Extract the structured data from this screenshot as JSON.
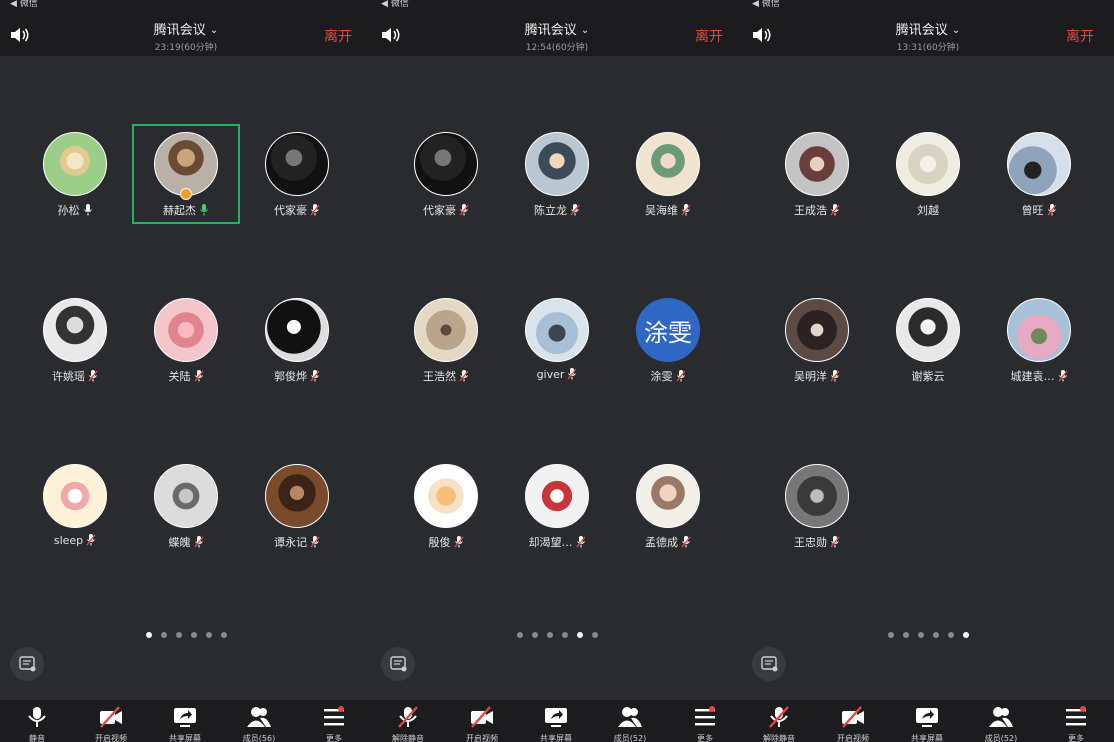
{
  "status": {
    "back_label": "◀ 微信"
  },
  "colors": {
    "leave": "#e8473f",
    "active_border": "#23b35a",
    "text_avatar_bg": "#2f68c4"
  },
  "screens": [
    {
      "title": "腾讯会议",
      "subtitle": "23:19(60分钟)",
      "leave": "离开",
      "participants": [
        {
          "name": "孙松",
          "mic": "on"
        },
        {
          "name": "赫起杰",
          "mic": "speaking"
        },
        {
          "name": "代家豪",
          "mic": "muted"
        },
        {
          "name": "许姚瑶",
          "mic": "muted"
        },
        {
          "name": "关陆",
          "mic": "muted"
        },
        {
          "name": "郭俊烨",
          "mic": "muted"
        },
        {
          "name": "sleep",
          "mic": "muted"
        },
        {
          "name": "蝶魄",
          "mic": "muted"
        },
        {
          "name": "谭永记",
          "mic": "muted"
        }
      ],
      "page": 1,
      "toolbar": [
        {
          "label": "静音",
          "icon": "mic-icon"
        },
        {
          "label": "开启视频",
          "icon": "video-off-icon"
        },
        {
          "label": "共享屏幕",
          "icon": "share-screen-icon"
        },
        {
          "label": "成员(56)",
          "icon": "members-icon"
        },
        {
          "label": "更多",
          "icon": "more-icon"
        }
      ]
    },
    {
      "title": "腾讯会议",
      "subtitle": "12:54(60分钟)",
      "leave": "离开",
      "participants": [
        {
          "name": "代家豪",
          "mic": "muted"
        },
        {
          "name": "陈立龙",
          "mic": "muted"
        },
        {
          "name": "吴海维",
          "mic": "muted"
        },
        {
          "name": "王浩然",
          "mic": "muted"
        },
        {
          "name": "giver",
          "mic": "muted"
        },
        {
          "name": "涂雯",
          "mic": "muted",
          "avatar_text": "涂雯"
        },
        {
          "name": "殷俊",
          "mic": "muted"
        },
        {
          "name": "却渴望…",
          "mic": "muted"
        },
        {
          "name": "孟德成",
          "mic": "muted"
        }
      ],
      "page": 5,
      "toolbar": [
        {
          "label": "解除静音",
          "icon": "mic-off-icon"
        },
        {
          "label": "开启视频",
          "icon": "video-off-icon"
        },
        {
          "label": "共享屏幕",
          "icon": "share-screen-icon"
        },
        {
          "label": "成员(52)",
          "icon": "members-icon"
        },
        {
          "label": "更多",
          "icon": "more-icon"
        }
      ]
    },
    {
      "title": "腾讯会议",
      "subtitle": "13:31(60分钟)",
      "leave": "离开",
      "participants": [
        {
          "name": "王成浩",
          "mic": "muted"
        },
        {
          "name": "刘越",
          "mic": "none"
        },
        {
          "name": "曾旺",
          "mic": "muted"
        },
        {
          "name": "吴明洋",
          "mic": "muted"
        },
        {
          "name": "谢紫云",
          "mic": "none"
        },
        {
          "name": "城建袁…",
          "mic": "muted"
        },
        {
          "name": "王忠勋",
          "mic": "muted"
        }
      ],
      "page": 6,
      "toolbar": [
        {
          "label": "解除静音",
          "icon": "mic-off-icon"
        },
        {
          "label": "开启视频",
          "icon": "video-off-icon"
        },
        {
          "label": "共享屏幕",
          "icon": "share-screen-icon"
        },
        {
          "label": "成员(52)",
          "icon": "members-icon"
        },
        {
          "label": "更多",
          "icon": "more-icon"
        }
      ]
    }
  ],
  "page_count": 6
}
